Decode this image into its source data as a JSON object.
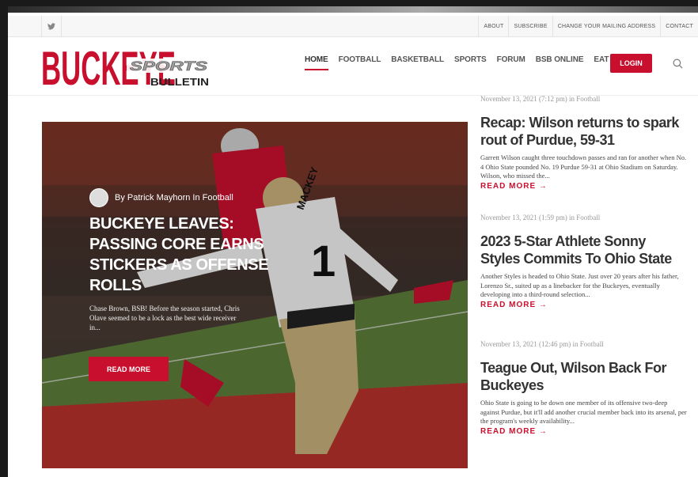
{
  "topbar": {
    "social_icon": "twitter-icon",
    "links": [
      "ABOUT",
      "SUBSCRIBE",
      "CHANGE YOUR MAILING ADDRESS",
      "CONTACT"
    ]
  },
  "header": {
    "logo": {
      "word1": "BUCKEYE",
      "word2": "SPORTS",
      "word3": "BULLETIN"
    },
    "nav": [
      "HOME",
      "FOOTBALL",
      "BASKETBALL",
      "SPORTS",
      "FORUM",
      "BSB ONLINE",
      "EAT & STAY"
    ],
    "active_nav": "HOME",
    "login_label": "LOGIN",
    "search_icon": "search-icon"
  },
  "hero": {
    "byline": "By Patrick Mayhorn In Football",
    "title": "BUCKEYE LEAVES: PASSING CORE EARNS STICKERS AS OFFENSE ROLLS",
    "excerpt": "Chase Brown, BSB! Before the season started, Chris Olave seemed to be a lock as the best wide receiver in...",
    "button": "READ MORE",
    "jersey_number": "1",
    "jersey_name": "MACKEY"
  },
  "posts": [
    {
      "meta": "November 13, 2021 (7:12 pm) in Football",
      "title": "Recap: Wilson returns to spark rout of Purdue, 59-31",
      "excerpt": "Garrett Wilson caught three touchdown passes and ran for another when No. 4 Ohio State pounded No. 19 Purdue 59-31 at Ohio Stadium on Saturday. Wilson, who missed the...",
      "more": "READ MORE →"
    },
    {
      "meta": "November 13, 2021 (1:59 pm) in Football",
      "title": "2023 5-Star Athlete Sonny Styles Commits To Ohio State",
      "excerpt": "Another Styles is headed to Ohio State. Just over 20 years after his father, Lorenzo Sr., suited up as a linebacker for the Buckeyes, eventually developing into a third-round selection...",
      "more": "READ MORE →"
    },
    {
      "meta": "November 13, 2021 (12:46 pm) in Football",
      "title": "Teague Out, Wilson Back For Buckeyes",
      "excerpt": "Ohio State is going to be down one member of its offensive two-deep against Purdue, but it'll add another crucial member back into its arsenal, per the program's weekly availability...",
      "more": "READ MORE →"
    }
  ],
  "colors": {
    "accent": "#c8102e",
    "text": "#333333",
    "meta": "#999999"
  }
}
